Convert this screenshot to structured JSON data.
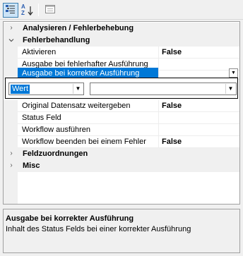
{
  "toolbar": {
    "buttons": [
      {
        "icon": "categorized-icon",
        "active": true
      },
      {
        "icon": "sort-alphabetical-icon",
        "active": false
      },
      {
        "icon": "property-pages-icon",
        "active": false
      }
    ],
    "sort_label": "AZ"
  },
  "categories": {
    "analyse": {
      "label": "Analysieren / Fehlerbehebung",
      "expanded": false
    },
    "fehler": {
      "label": "Fehlerbehandlung",
      "expanded": true
    },
    "feld": {
      "label": "Feldzuordnungen",
      "expanded": false
    },
    "misc": {
      "label": "Misc",
      "expanded": false
    }
  },
  "properties": {
    "aktivieren": {
      "name": "Aktivieren",
      "value": "False"
    },
    "fehlerhaft": {
      "name": "Ausgabe bei fehlerhafter Ausführung",
      "value": ""
    },
    "korrekt": {
      "name": "Ausgabe bei korrekter Ausführung",
      "value": "",
      "selected": true
    },
    "original": {
      "name": "Original Datensatz weitergeben",
      "value": "False"
    },
    "status": {
      "name": "Status Feld",
      "value": ""
    },
    "workflow": {
      "name": "Workflow ausführen",
      "value": ""
    },
    "beenden": {
      "name": "Workflow beenden bei einem Fehler",
      "value": "False"
    }
  },
  "editor": {
    "type_select": {
      "value": "Wert"
    },
    "value_select": {
      "value": ""
    }
  },
  "description": {
    "title": "Ausgabe bei korrekter Ausführung",
    "text": "Inhalt des Status Felds bei einer korrekter Ausführung"
  },
  "colors": {
    "selection": "#0078d7",
    "gutter": "#f0f0f0",
    "background": "#f0f0f0"
  }
}
